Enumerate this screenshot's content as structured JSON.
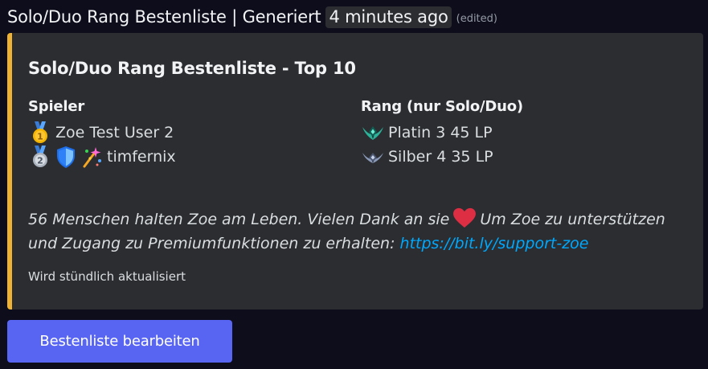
{
  "header": {
    "title": "Solo/Duo Rang Bestenliste | Generiert",
    "timestamp": "4 minutes ago",
    "edited": "(edited)"
  },
  "embed": {
    "accent_color": "#f0b232",
    "title": "Solo/Duo Rang Bestenliste - Top 10",
    "players": {
      "header": "Spieler",
      "rows": [
        {
          "icons": [
            "medal-1-icon"
          ],
          "name": "Zoe Test User 2"
        },
        {
          "icons": [
            "medal-2-icon",
            "shield-badge-icon",
            "sparkle-badge-icon"
          ],
          "name": "timfernix"
        }
      ]
    },
    "ranks": {
      "header": "Rang (nur Solo/Duo)",
      "rows": [
        {
          "icon": "platinum-rank-icon",
          "label": "Platin 3 45 LP"
        },
        {
          "icon": "silver-rank-icon",
          "label": "Silber 4 35 LP"
        }
      ]
    },
    "description": {
      "part1": "56 Menschen halten Zoe am Leben. Vielen Dank an sie",
      "heart_icon": "heart-icon",
      "part2": "Um Zoe zu unterstützen und Zugang zu Premiumfunktionen zu erhalten:",
      "link": "https://bit.ly/support-zoe"
    },
    "footer": "Wird stündlich aktualisiert"
  },
  "button": {
    "label": "Bestenliste bearbeiten",
    "color": "#5865f2"
  }
}
